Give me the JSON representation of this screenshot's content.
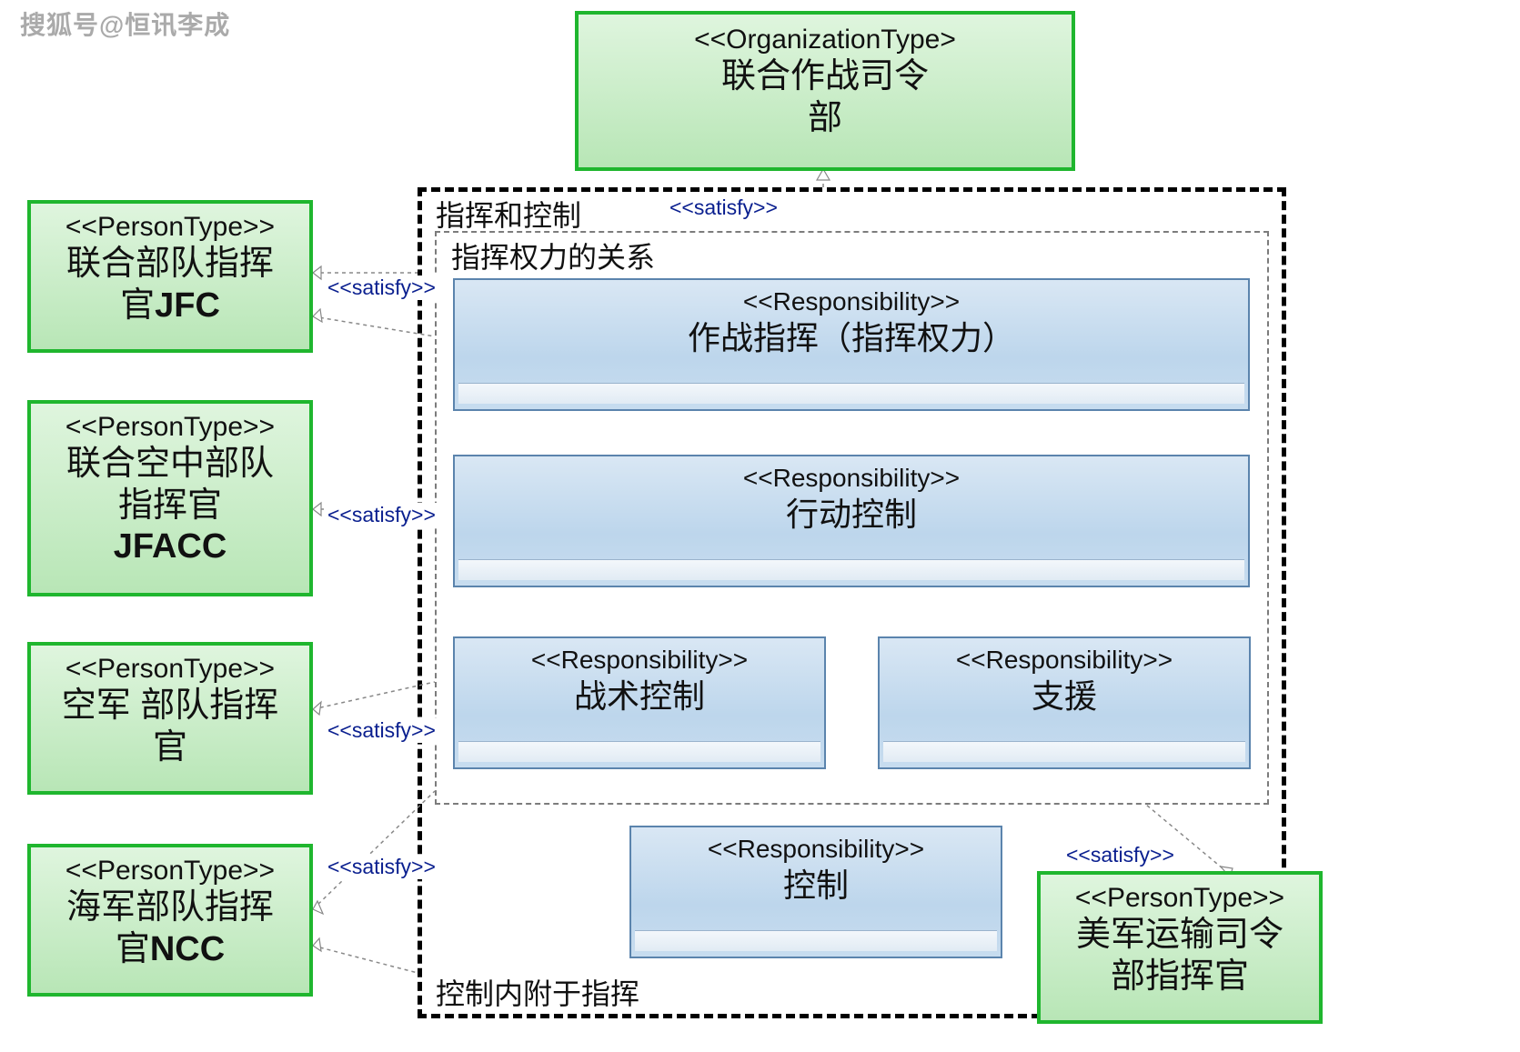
{
  "watermark": "搜狐号@恒讯李成",
  "stereotypes": {
    "org": "<<OrganizationType>",
    "person": "<<PersonType>>",
    "resp": "<<Responsibility>>",
    "satisfy": "<<satisfy>>"
  },
  "top_org": {
    "title_l1": "联合作战司令",
    "title_l2": "部"
  },
  "left": {
    "jfc": {
      "l1": "联合部队指挥",
      "l2": "官",
      "l2b": "JFC"
    },
    "jfacc": {
      "l1": "联合空中部队",
      "l2": "指挥官",
      "l3": "JFACC"
    },
    "af": {
      "l1": "空军 部队指挥",
      "l2": "官"
    },
    "ncc": {
      "l1": "海军部队指挥",
      "l2": "官",
      "l2b": "NCC"
    }
  },
  "right_person": {
    "l1": "美军运输司令",
    "l2": "部指挥官"
  },
  "outer_box": {
    "title": "指挥和控制",
    "footer": "控制内附于指挥"
  },
  "inner_box": {
    "title": "指挥权力的关系"
  },
  "resp": {
    "r1": "作战指挥（指挥权力）",
    "r2": "行动控制",
    "r3": "战术控制",
    "r4": "支援",
    "r5": "控制"
  }
}
